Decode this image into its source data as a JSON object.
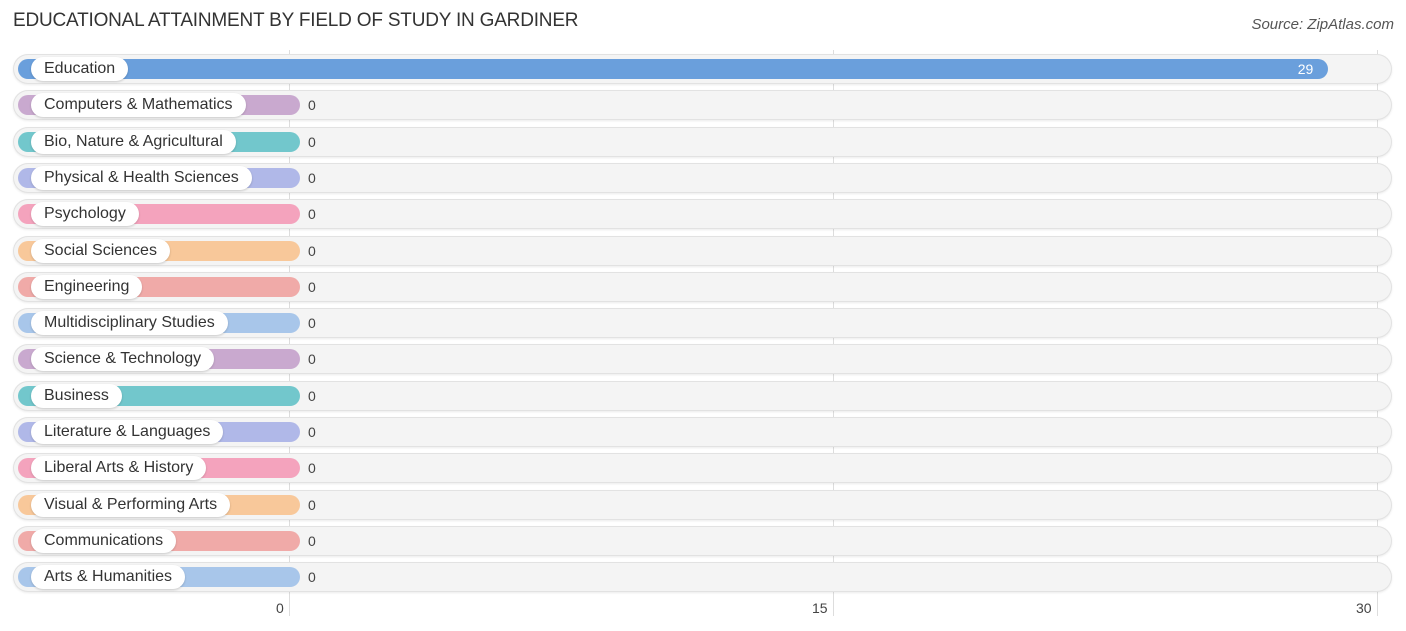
{
  "title": "EDUCATIONAL ATTAINMENT BY FIELD OF STUDY IN GARDINER",
  "source": "Source: ZipAtlas.com",
  "chart_data": {
    "type": "bar",
    "orientation": "horizontal",
    "title": "EDUCATIONAL ATTAINMENT BY FIELD OF STUDY IN GARDINER",
    "xlabel": "",
    "ylabel": "",
    "xlim": [
      0,
      30
    ],
    "xticks": [
      0,
      15,
      30
    ],
    "grid": true,
    "categories": [
      "Education",
      "Computers & Mathematics",
      "Bio, Nature & Agricultural",
      "Physical & Health Sciences",
      "Psychology",
      "Social Sciences",
      "Engineering",
      "Multidisciplinary Studies",
      "Science & Technology",
      "Business",
      "Literature & Languages",
      "Liberal Arts & History",
      "Visual & Performing Arts",
      "Communications",
      "Arts & Humanities"
    ],
    "values": [
      29,
      0,
      0,
      0,
      0,
      0,
      0,
      0,
      0,
      0,
      0,
      0,
      0,
      0,
      0
    ],
    "colors": [
      "#6a9fdc",
      "#c9a9cf",
      "#72c7cc",
      "#b0b8e8",
      "#f4a3bd",
      "#f8c89a",
      "#f0aaa8",
      "#a8c6ea",
      "#c9a9cf",
      "#72c7cc",
      "#b0b8e8",
      "#f4a3bd",
      "#f8c89a",
      "#f0aaa8",
      "#a8c6ea"
    ]
  }
}
